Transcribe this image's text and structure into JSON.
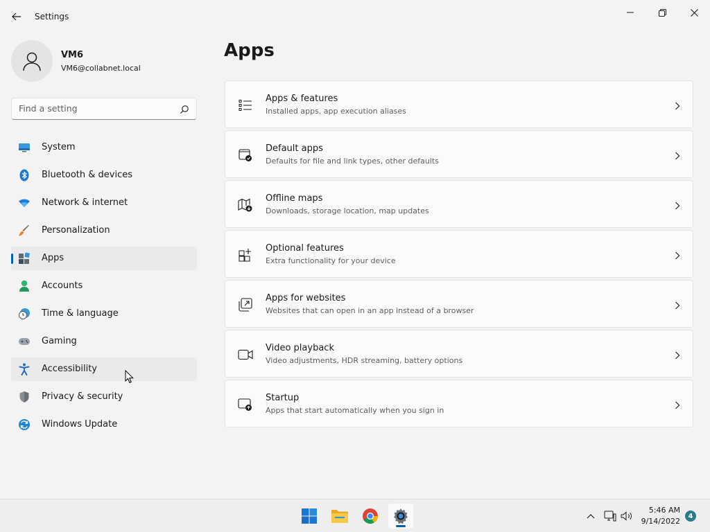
{
  "window": {
    "title": "Settings"
  },
  "profile": {
    "name": "VM6",
    "email": "VM6@collabnet.local"
  },
  "search": {
    "placeholder": "Find a setting",
    "value": ""
  },
  "nav": {
    "items": [
      {
        "label": "System",
        "icon": "system-icon"
      },
      {
        "label": "Bluetooth & devices",
        "icon": "bluetooth-icon"
      },
      {
        "label": "Network & internet",
        "icon": "network-icon"
      },
      {
        "label": "Personalization",
        "icon": "brush-icon"
      },
      {
        "label": "Apps",
        "icon": "apps-icon"
      },
      {
        "label": "Accounts",
        "icon": "accounts-icon"
      },
      {
        "label": "Time & language",
        "icon": "time-language-icon"
      },
      {
        "label": "Gaming",
        "icon": "gamepad-icon"
      },
      {
        "label": "Accessibility",
        "icon": "accessibility-icon"
      },
      {
        "label": "Privacy & security",
        "icon": "shield-icon"
      },
      {
        "label": "Windows Update",
        "icon": "windows-update-icon"
      }
    ],
    "selected": "Apps"
  },
  "main": {
    "title": "Apps",
    "cards": [
      {
        "title": "Apps & features",
        "subtitle": "Installed apps, app execution aliases",
        "icon": "list-icon"
      },
      {
        "title": "Default apps",
        "subtitle": "Defaults for file and link types, other defaults",
        "icon": "default-apps-icon"
      },
      {
        "title": "Offline maps",
        "subtitle": "Downloads, storage location, map updates",
        "icon": "map-icon"
      },
      {
        "title": "Optional features",
        "subtitle": "Extra functionality for your device",
        "icon": "optional-features-icon"
      },
      {
        "title": "Apps for websites",
        "subtitle": "Websites that can open in an app instead of a browser",
        "icon": "open-external-icon"
      },
      {
        "title": "Video playback",
        "subtitle": "Video adjustments, HDR streaming, battery options",
        "icon": "video-icon"
      },
      {
        "title": "Startup",
        "subtitle": "Apps that start automatically when you sign in",
        "icon": "startup-icon"
      }
    ]
  },
  "taskbar": {
    "apps": [
      "windows-start-icon",
      "file-explorer-icon",
      "chrome-icon",
      "settings-gear-icon"
    ],
    "active_app": "settings-gear-icon",
    "clock": {
      "time": "5:46 AM",
      "date": "9/14/2022"
    },
    "notifications": "4"
  },
  "colors": {
    "accent": "#005fb8",
    "background": "#f3f3f3",
    "card": "#fbfbfb"
  }
}
